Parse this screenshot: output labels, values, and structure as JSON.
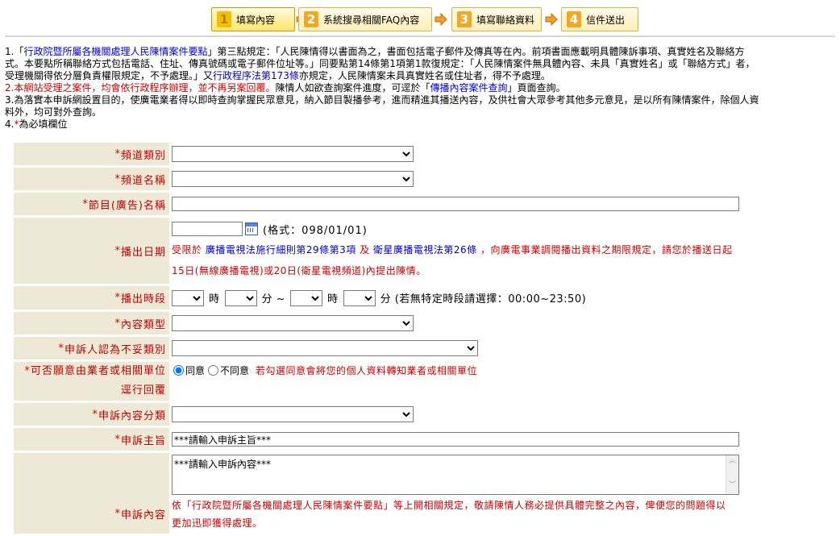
{
  "steps": [
    {
      "num": "1",
      "label": "填寫內容"
    },
    {
      "num": "2",
      "label": "系統搜尋相關FAQ內容"
    },
    {
      "num": "3",
      "label": "填寫聯絡資料"
    },
    {
      "num": "4",
      "label": "信件送出"
    }
  ],
  "notes": {
    "n1_pre": "1.「",
    "n1_link": "行政院暨所屬各機關處理人民陳情案件要點",
    "n1_post": "」第三點規定：「人民陳情得以書面為之，書面包括電子郵件及傳真等在內。前項書面應載明具體陳訴事項、真實姓名及聯絡方",
    "n1_line2": "式。本要點所稱聯絡方式包括電話、住址、傳真號碼或電子郵件位址等。」同要點第14條第1項第1款復規定：「人民陳情案件無具體內容、未具「真實姓名」或「聯絡方式」者，",
    "n1_line3_pre": "受理機關得依分層負責權限規定，不予處理。」又",
    "n1_line3_link": "行政程序法第173條",
    "n1_line3_post": "亦規定，人民陳情案未具真實姓名或住址者，得不予處理。",
    "n2_red": "2.本網站受理之案件，均會依行政程序辦理，並不再另案回覆。",
    "n2_mid": "陳情人如欲查詢案件進度，可逕於「",
    "n2_link": "傳播內容案件查詢",
    "n2_post": "」頁面查詢。",
    "n3_line1": "3.為落實本申訴網設置目的，使廣電業者得以即時查詢掌握民眾意見，納入節目製播參考，進而精進其播送內容，及供社會大眾參考其他多元意見，是以所有陳情案件，除個人資",
    "n3_line2": "料外，均可對外查詢。",
    "n4_pre": "4.",
    "n4_star": "*",
    "n4_post": "為必填欄位"
  },
  "form": {
    "star": "*",
    "channel_type": "頻道類別",
    "channel_name": "頻道名稱",
    "program_name": "節目(廣告)名稱",
    "air_date": "播出日期",
    "air_date_format": "(格式：098/01/01)",
    "air_date_note_pre": "受限於",
    "air_date_link1": "廣播電視法施行細則第29條第3項",
    "air_date_and": "及",
    "air_date_link2": "衛星廣播電視法第26條",
    "air_date_note_post": "，向廣電事業調閱播出資料之期限規定，請您於播送日起",
    "air_date_note_line2": "15日(無線廣播電視)或20日(衛星電視頻道)內提出陳情。",
    "air_time": "播出時段",
    "hour": "時",
    "minute": "分 ~",
    "hour2": "時",
    "minute2": "分 (若無特定時段請選擇：00:00~23:50)",
    "content_type": "內容類型",
    "improper": "申訴人認為不妥類別",
    "consent_label_line1": "可否願意由業者或相關單位",
    "consent_label_line2": "逕行回覆",
    "agree": "同意",
    "disagree": "不同意",
    "consent_note": "若勾選同意會將您的個人資料轉知業者或相關單位",
    "category": "申訴內容分類",
    "subject": "申訴主旨",
    "subject_value": "***請輸入申訴主旨***",
    "content": "申訴內容",
    "content_value": "***請輸入申訴內容***",
    "content_note_pre": "依「",
    "content_note_link": "行政院暨所屬各機關處理人民陳情案件要點",
    "content_note_post": "」等上開相關規定，敬請陳情人務必提供具體完整之內容，俾便您的問題得以",
    "content_note_line2": "更加迅即獲得處理。"
  }
}
